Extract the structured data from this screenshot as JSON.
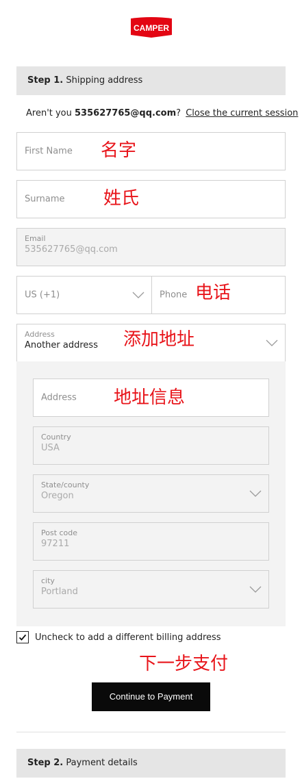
{
  "brand": {
    "logo_text": "CAMPER",
    "color": "#e30613"
  },
  "step1": {
    "number": "Step 1.",
    "title": "Shipping address"
  },
  "session": {
    "prefix": "Aren't you ",
    "email": "535627765@qq.com",
    "suffix": "?",
    "close_link": "Close the current session"
  },
  "form": {
    "first_name": {
      "placeholder": "First Name",
      "annotation": "名字"
    },
    "surname": {
      "placeholder": "Surname",
      "annotation": "姓氏"
    },
    "email": {
      "label": "Email",
      "value": "535627765@qq.com"
    },
    "country_code": {
      "value": "US (+1)"
    },
    "phone": {
      "placeholder": "Phone",
      "annotation": "电话"
    },
    "address_select": {
      "label": "Address",
      "value": "Another address",
      "annotation": "添加地址"
    },
    "address": {
      "placeholder": "Address",
      "annotation": "地址信息"
    },
    "country": {
      "label": "Country",
      "value": "USA"
    },
    "state": {
      "label": "State/county",
      "value": "Oregon"
    },
    "post_code": {
      "label": "Post code",
      "value": "97211"
    },
    "city": {
      "label": "city",
      "value": "Portland"
    }
  },
  "billing": {
    "checked": true,
    "label": "Uncheck to add a different billing address"
  },
  "continue": {
    "label": "Continue to Payment",
    "annotation": "下一步支付"
  },
  "step2": {
    "number": "Step 2.",
    "title": "Payment details"
  },
  "icons": [
    "camper-logo",
    "chevron-down-icon",
    "checkmark-icon"
  ],
  "colors": {
    "annotation": "#e8141a",
    "button": "#0a0a0a",
    "step_bar": "#e5e5e5",
    "disabled_bg": "#f3f3f3"
  }
}
